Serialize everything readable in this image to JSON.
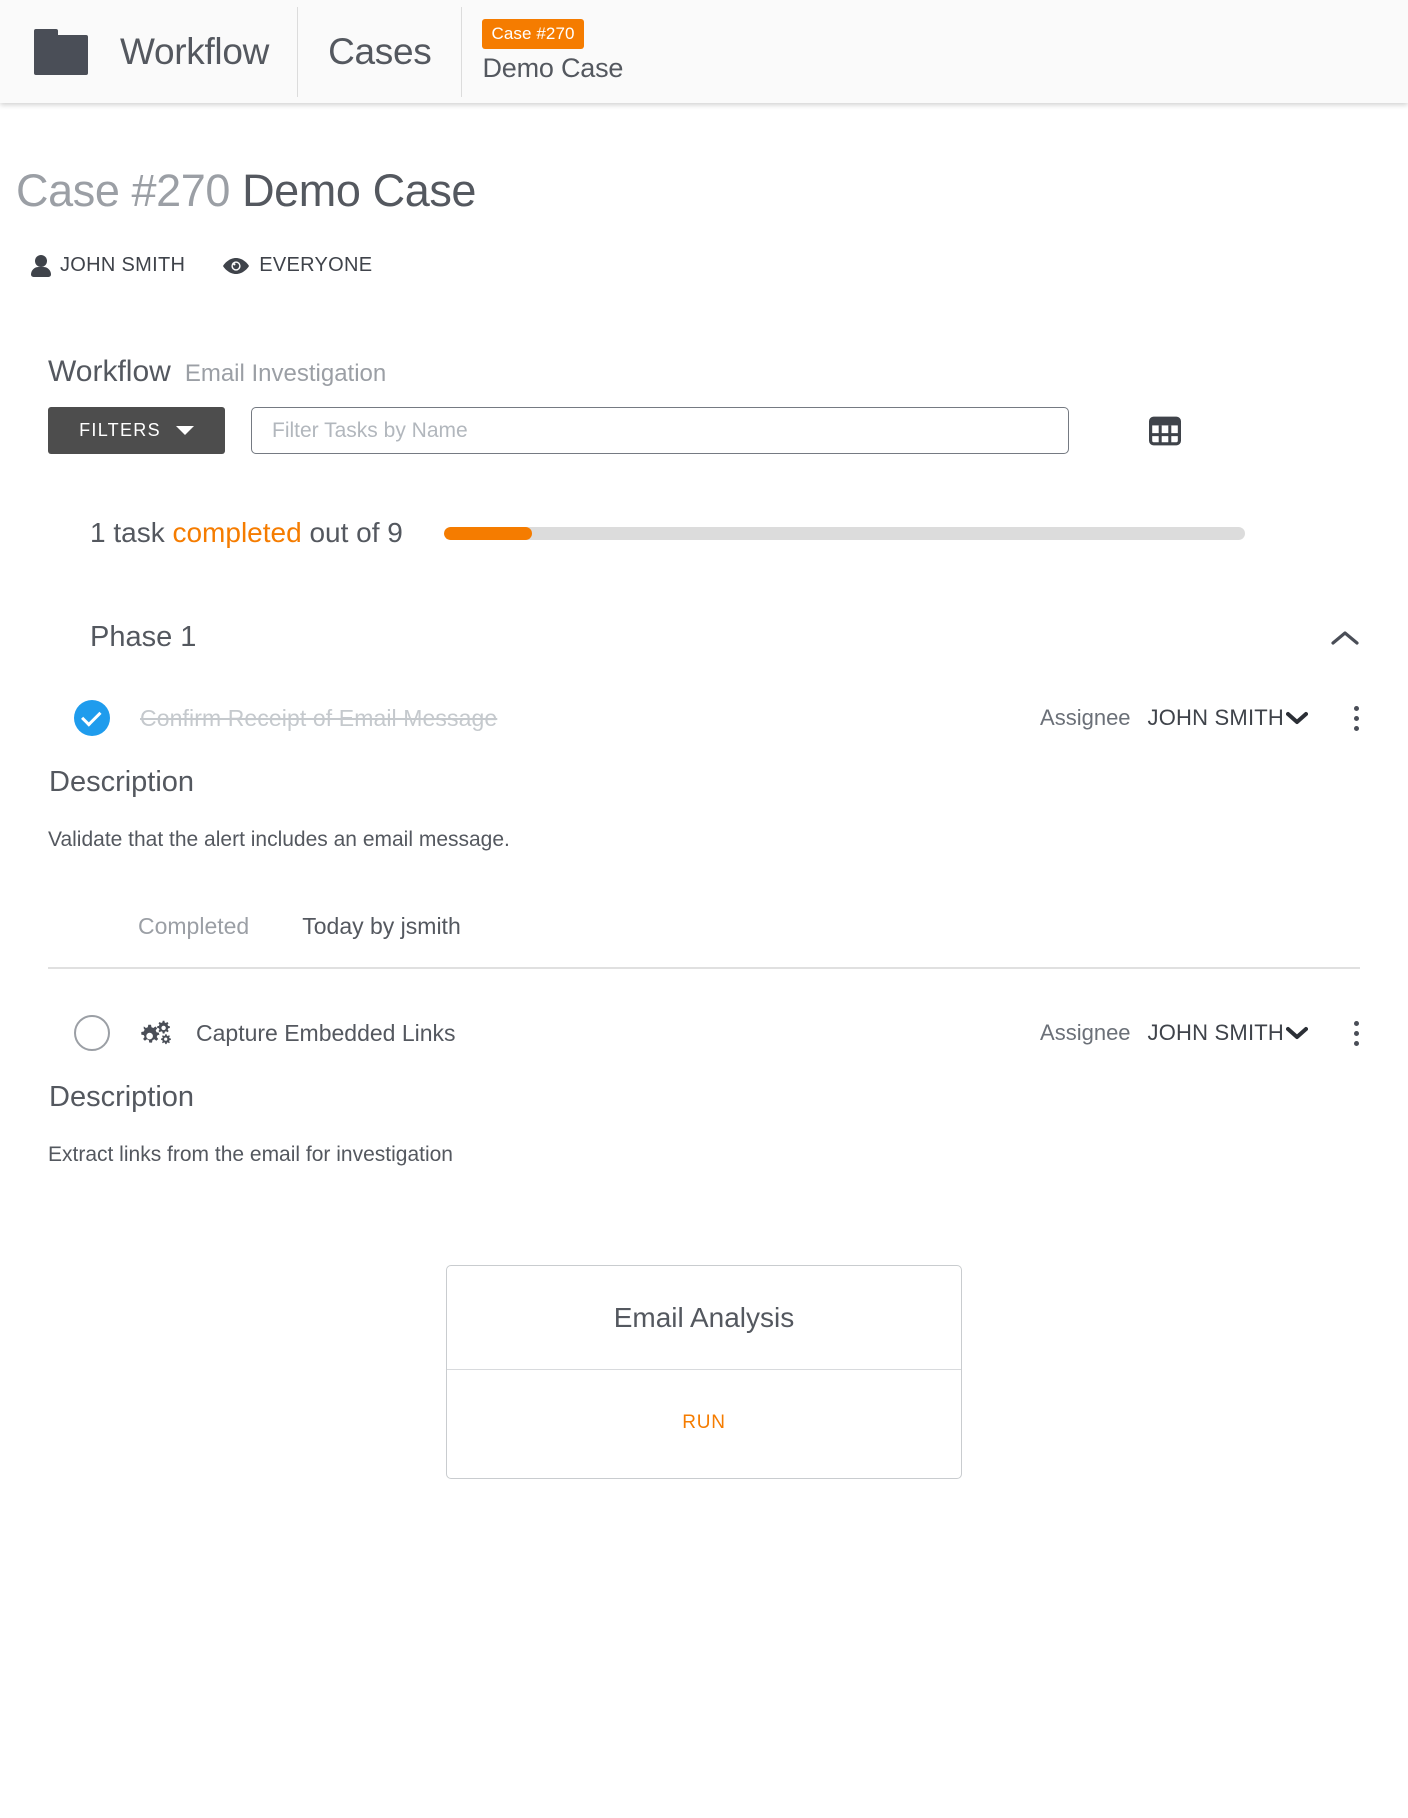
{
  "topbar": {
    "folder_icon": "folder-icon",
    "brand": "Workflow",
    "crumb_cases": "Cases",
    "case_badge": "Case #270",
    "case_name": "Demo Case"
  },
  "page_header": {
    "case_number": "Case #270",
    "case_title": "Demo Case",
    "owner_icon": "person-icon",
    "owner": "JOHN SMITH",
    "visibility_icon": "eye-icon",
    "visibility": "EVERYONE"
  },
  "workflow": {
    "heading": "Workflow",
    "name": "Email Investigation",
    "filters_button": "FILTERS",
    "filters_caret_icon": "chevron-down-icon",
    "search_placeholder": "Filter Tasks by Name",
    "search_value": "",
    "grid_view_icon": "grid-table-icon",
    "progress": {
      "prefix": "1 task",
      "highlight": "completed",
      "suffix": "out of 9",
      "completed_count": 1,
      "total_count": 9,
      "percent": 11,
      "fill_color": "#f57c00",
      "track_color": "#dcdcdc"
    }
  },
  "phase": {
    "title": "Phase 1",
    "collapse_icon": "chevron-up-icon",
    "expanded": true
  },
  "tasks": [
    {
      "status": "done",
      "status_icon": "check-circle-icon",
      "name": "Confirm Receipt of Email Message",
      "assignee_label": "Assignee",
      "assignee": "JOHN SMITH",
      "assignee_caret_icon": "chevron-down-icon",
      "menu_icon": "kebab-menu-icon",
      "description_title": "Description",
      "description": "Validate that the alert includes an email message.",
      "status_label": "Completed",
      "status_value": "Today by jsmith"
    },
    {
      "status": "open",
      "status_icon": "empty-circle-icon",
      "automation_icon": "gears-icon",
      "name": "Capture Embedded Links",
      "assignee_label": "Assignee",
      "assignee": "JOHN SMITH",
      "assignee_caret_icon": "chevron-down-icon",
      "menu_icon": "kebab-menu-icon",
      "description_title": "Description",
      "description": "Extract links from the email for investigation"
    }
  ],
  "action_card": {
    "title": "Email Analysis",
    "run_label": "RUN",
    "accent_color": "#f57c00"
  }
}
